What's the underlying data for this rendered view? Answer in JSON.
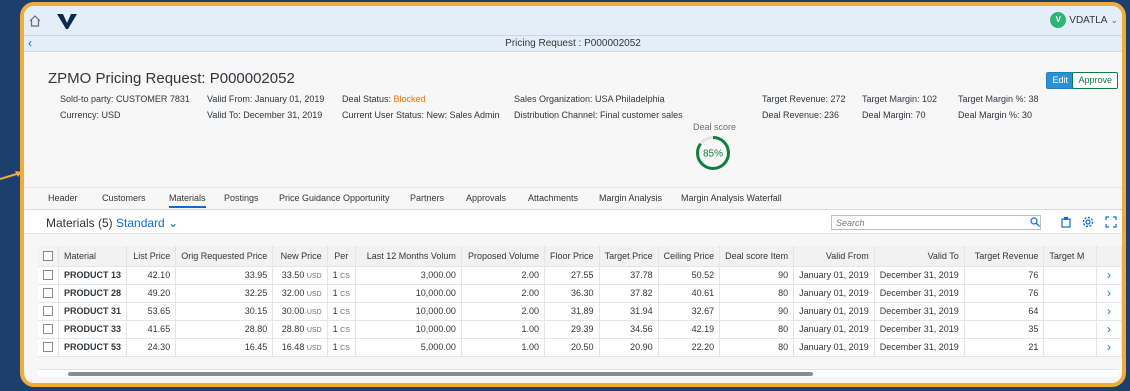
{
  "shell": {
    "user_initial": "V",
    "user_name": "VDATLA"
  },
  "title_bar": {
    "title": "Pricing Request : P000002052"
  },
  "header": {
    "title": "ZPMO Pricing Request: P000002052",
    "edit_label": "Edit",
    "approve_label": "Approve",
    "sold_to": "Sold-to party: CUSTOMER 7831",
    "currency": "Currency: USD",
    "valid_from": "Valid From: January 01, 2019",
    "valid_to": "Valid To: December 31, 2019",
    "deal_status_label": "Deal Status: ",
    "deal_status_value": "Blocked",
    "user_status": "Current User Status: New: Sales Admin",
    "sales_org": "Sales Organization: USA Philadelphia",
    "dist_channel": "Distribution Channel: Final customer sales",
    "deal_score_label": "Deal score",
    "deal_score_value": "85%",
    "deal_score_fraction": 0.85,
    "target_revenue": "Target Revenue: 272",
    "deal_revenue": "Deal Revenue: 236",
    "target_margin": "Target Margin: 102",
    "deal_margin": "Deal Margin: 70",
    "target_margin_pct": "Target Margin %: 38",
    "deal_margin_pct": "Deal Margin %: 30"
  },
  "tabs": [
    "Header",
    "Customers",
    "Materials",
    "Postings",
    "Price Guidance Opportunity",
    "Partners",
    "Approvals",
    "Attachments",
    "Margin Analysis",
    "Margin Analysis Waterfall"
  ],
  "active_tab": "Materials",
  "table_toolbar": {
    "title": "Materials (5)",
    "variant": "Standard",
    "search_placeholder": "Search"
  },
  "columns": [
    "Material",
    "List Price",
    "Orig Requested Price",
    "New Price",
    "Per",
    "Last 12 Months Volum",
    "Proposed Volume",
    "Floor Price",
    "Target Price",
    "Ceiling Price",
    "Deal score Item",
    "Valid From",
    "Valid To",
    "Target Revenue",
    "Target M"
  ],
  "rows": [
    {
      "material": "PRODUCT 13",
      "list_price": "42.10",
      "orig_price": "33.95",
      "new_price": "33.50",
      "currency": "USD",
      "per": "1",
      "per_unit": "CS",
      "last12": "3,000.00",
      "proposed": "2.00",
      "floor": "27.55",
      "target": "37.78",
      "ceiling": "50.52",
      "score": "90",
      "valid_from": "January 01, 2019",
      "valid_to": "December 31, 2019",
      "target_revenue": "76",
      "target_margin": ""
    },
    {
      "material": "PRODUCT 28",
      "list_price": "49.20",
      "orig_price": "32.25",
      "new_price": "32.00",
      "currency": "USD",
      "per": "1",
      "per_unit": "CS",
      "last12": "10,000.00",
      "proposed": "2.00",
      "floor": "36.30",
      "target": "37.82",
      "ceiling": "40.61",
      "score": "80",
      "valid_from": "January 01, 2019",
      "valid_to": "December 31, 2019",
      "target_revenue": "76",
      "target_margin": ""
    },
    {
      "material": "PRODUCT 31",
      "list_price": "53.65",
      "orig_price": "30.15",
      "new_price": "30.00",
      "currency": "USD",
      "per": "1",
      "per_unit": "CS",
      "last12": "10,000.00",
      "proposed": "2.00",
      "floor": "31.89",
      "target": "31.94",
      "ceiling": "32.67",
      "score": "90",
      "valid_from": "January 01, 2019",
      "valid_to": "December 31, 2019",
      "target_revenue": "64",
      "target_margin": ""
    },
    {
      "material": "PRODUCT 33",
      "list_price": "41.65",
      "orig_price": "28.80",
      "new_price": "28.80",
      "currency": "USD",
      "per": "1",
      "per_unit": "CS",
      "last12": "10,000.00",
      "proposed": "1.00",
      "floor": "29.39",
      "target": "34.56",
      "ceiling": "42.19",
      "score": "80",
      "valid_from": "January 01, 2019",
      "valid_to": "December 31, 2019",
      "target_revenue": "35",
      "target_margin": ""
    },
    {
      "material": "PRODUCT 53",
      "list_price": "24.30",
      "orig_price": "16.45",
      "new_price": "16.48",
      "currency": "USD",
      "per": "1",
      "per_unit": "CS",
      "last12": "5,000.00",
      "proposed": "1.00",
      "floor": "20.50",
      "target": "20.90",
      "ceiling": "22.20",
      "score": "80",
      "valid_from": "January 01, 2019",
      "valid_to": "December 31, 2019",
      "target_revenue": "21",
      "target_margin": ""
    }
  ],
  "colors": {
    "accent": "#0a6ed1",
    "blocked": "#e9730c",
    "score_ring": "#107e3e",
    "frame": "#f0ab3c",
    "background": "#1d3f6e"
  },
  "icons": {
    "home": "home-icon",
    "logo": "brand-logo",
    "back": "back-icon",
    "search": "search-icon",
    "export": "export-icon",
    "settings": "gear-icon",
    "fullscreen": "fullscreen-icon",
    "row_nav": "chevron-right-icon"
  }
}
